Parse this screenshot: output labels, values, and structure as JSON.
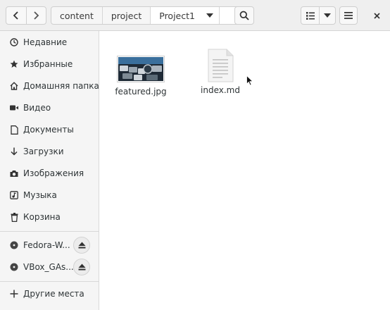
{
  "breadcrumb": {
    "items": [
      "content",
      "project",
      "Project1"
    ]
  },
  "sidebar": {
    "items": [
      {
        "label": "Недавние",
        "icon": "clock-icon"
      },
      {
        "label": "Избранные",
        "icon": "star-icon"
      },
      {
        "label": "Домашняя папка",
        "icon": "home-icon"
      },
      {
        "label": "Видео",
        "icon": "video-icon"
      },
      {
        "label": "Документы",
        "icon": "document-icon"
      },
      {
        "label": "Загрузки",
        "icon": "download-icon"
      },
      {
        "label": "Изображения",
        "icon": "camera-icon"
      },
      {
        "label": "Музыка",
        "icon": "music-icon"
      },
      {
        "label": "Корзина",
        "icon": "trash-icon"
      }
    ],
    "devices": [
      {
        "label": "Fedora-W...",
        "icon": "disc-icon"
      },
      {
        "label": "VBox_GAs...",
        "icon": "disc-icon"
      }
    ],
    "other": {
      "label": "Другие места",
      "icon": "plus-icon"
    }
  },
  "files": [
    {
      "name": "featured.jpg",
      "kind": "image"
    },
    {
      "name": "index.md",
      "kind": "text"
    }
  ],
  "colors": {
    "header_bg": "#efefef",
    "sidebar_bg": "#f5f5f5",
    "accent": "#3584e4"
  }
}
